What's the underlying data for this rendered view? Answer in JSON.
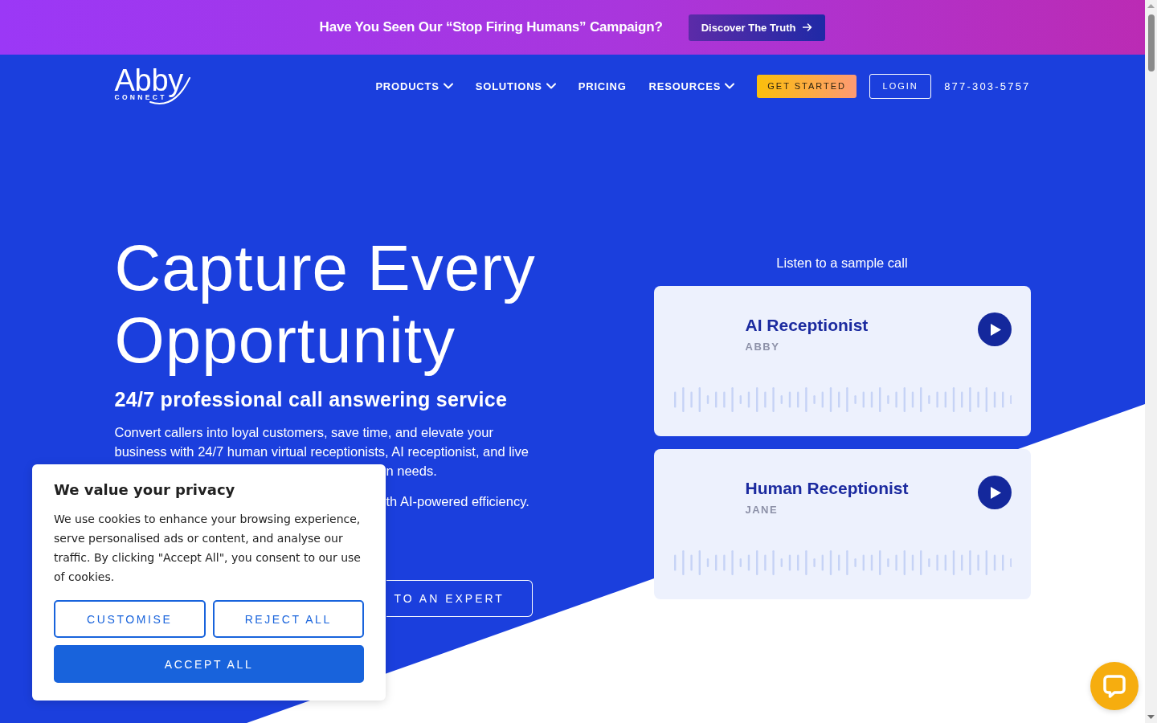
{
  "promo_banner": {
    "text": "Have You Seen Our “Stop Firing Humans” Campaign?",
    "button": "Discover The Truth"
  },
  "nav": {
    "logo": {
      "wordmark": "Abby",
      "tagline": "CONNECT"
    },
    "items": [
      {
        "label": "PRODUCTS",
        "dropdown": true
      },
      {
        "label": "SOLUTIONS",
        "dropdown": true
      },
      {
        "label": "PRICING",
        "dropdown": false
      },
      {
        "label": "RESOURCES",
        "dropdown": true
      }
    ],
    "cta_button": "GET STARTED",
    "login_button": "LOGIN",
    "phone": "877-303-5757"
  },
  "hero": {
    "title_lines": [
      "Capture Every",
      "Opportunity"
    ],
    "subtitle": "24/7 professional call answering service",
    "paragraph_1": "Convert callers into loyal customers, save time, and elevate your business with 24/7 human virtual receptionists, AI receptionist, and live",
    "paragraph_1_end": "n needs.",
    "paragraph_2_end": "th AI-powered efficiency.",
    "button_end": "TO AN EXPERT"
  },
  "samples": {
    "heading": "Listen to a sample call",
    "cards": [
      {
        "title": "AI Receptionist",
        "voice": "ABBY"
      },
      {
        "title": "Human Receptionist",
        "voice": "JANE"
      }
    ]
  },
  "cookie_banner": {
    "title": "We value your privacy",
    "text": "We use cookies to enhance your browsing experience, serve personalised ads or content, and analyse our traffic. By clicking \"Accept All\", you consent to our use of cookies.",
    "buttons": [
      {
        "label": "CUSTOMISE",
        "kind": "outline"
      },
      {
        "label": "REJECT ALL",
        "kind": "outline"
      },
      {
        "label": "ACCEPT ALL",
        "kind": "filled"
      }
    ]
  }
}
